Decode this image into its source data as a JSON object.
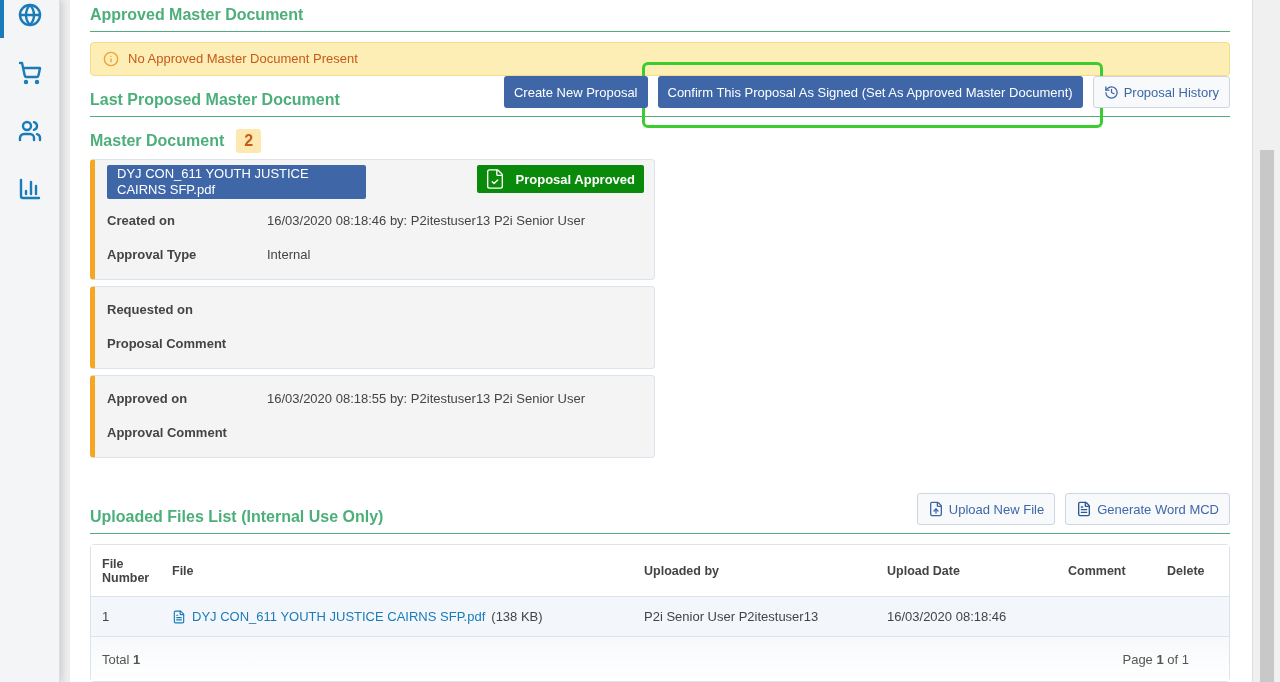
{
  "sidebar": {
    "items": [
      {
        "selected": true
      },
      {
        "selected": false
      },
      {
        "selected": false
      },
      {
        "selected": false
      }
    ]
  },
  "approved_section": {
    "title": "Approved Master Document",
    "alert": "No Approved Master Document Present"
  },
  "proposal_section": {
    "title": "Last Proposed Master Document",
    "buttons": [
      {
        "label": "Create New Proposal",
        "kind": "primary",
        "highlighted": false
      },
      {
        "label": "Confirm This Proposal As Signed (Set As Approved Master Document)",
        "kind": "primary",
        "highlighted": true
      },
      {
        "label": "Proposal History",
        "kind": "history",
        "highlighted": false
      }
    ]
  },
  "master_document": {
    "title": "Master Document",
    "count": "2",
    "file": "DYJ CON_611 YOUTH JUSTICE CAIRNS SFP.pdf",
    "status": "Proposal Approved",
    "cards": [
      {
        "fields": [
          {
            "label": "Created on",
            "value": "16/03/2020 08:18:46 by: P2itestuser13 P2i Senior User"
          },
          {
            "label": "Approval Type",
            "value": "Internal"
          }
        ]
      },
      {
        "fields": [
          {
            "label": "Requested on"
          },
          {
            "label": "Proposal Comment"
          }
        ]
      },
      {
        "fields": [
          {
            "label": "Approved on",
            "value": "16/03/2020 08:18:55 by: P2itestuser13 P2i Senior User"
          },
          {
            "label": "Approval Comment"
          }
        ]
      }
    ]
  },
  "files_section": {
    "title": "Uploaded Files List (Internal Use Only)",
    "buttons": [
      {
        "label": "Upload New File",
        "kind": "upload"
      },
      {
        "label": "Generate Word MCD",
        "kind": "word"
      }
    ],
    "table": {
      "columns": [
        "File Number",
        "File",
        "Uploaded by",
        "Upload Date",
        "Comment",
        "Delete"
      ],
      "rows": [
        {
          "number": "1",
          "file": "DYJ CON_611 YOUTH JUSTICE CAIRNS SFP.pdf",
          "size": "(138 KB)",
          "uploaded_by": "P2i Senior User P2itestuser13",
          "date": "16/03/2020 08:18:46"
        }
      ],
      "total": "Total **1**",
      "pages": "Page **1** of 1"
    }
  }
}
